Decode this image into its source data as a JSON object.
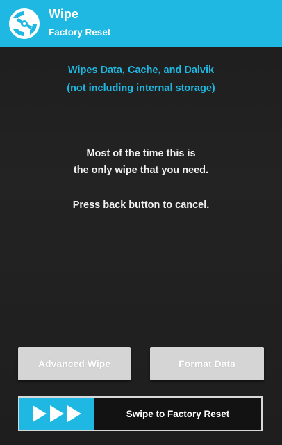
{
  "header": {
    "title": "Wipe",
    "subtitle": "Factory Reset",
    "logo_icon": "twrp-logo-icon",
    "color": "#1fb8e2"
  },
  "info": {
    "line1": "Wipes Data, Cache, and Dalvik",
    "line2": "(not including internal storage)",
    "message_line1": "Most of the time this is",
    "message_line2": "the only wipe that you need.",
    "message_line3": "Press back button to cancel."
  },
  "buttons": {
    "advanced_wipe": "Advanced Wipe",
    "format_data": "Format Data"
  },
  "slider": {
    "label": "Swipe to Factory Reset",
    "arrow_icon": "triple-arrow-right-icon",
    "accent": "#1fb8e2"
  }
}
